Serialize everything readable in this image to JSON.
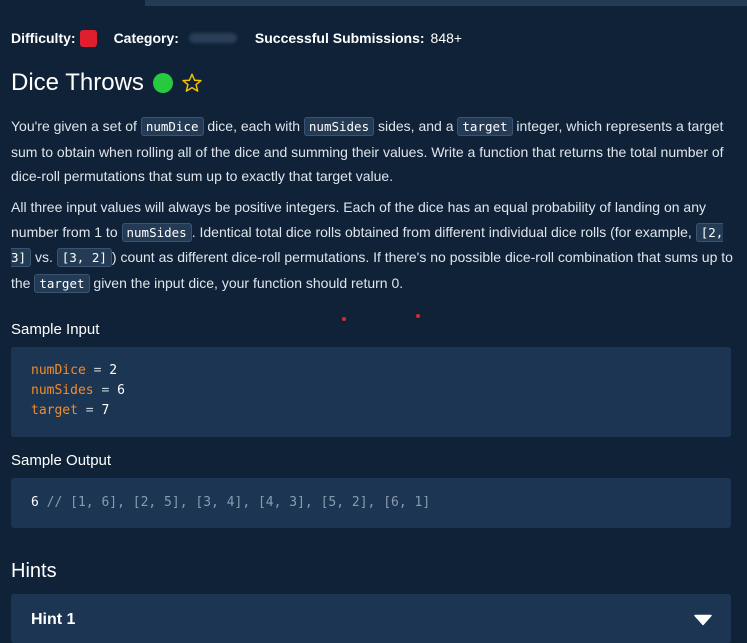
{
  "meta": {
    "difficulty_label": "Difficulty:",
    "difficulty_color": "#e01e2d",
    "category_label": "Category:",
    "subs_label": "Successful Submissions:",
    "subs_value": "848+"
  },
  "title": "Dice Throws",
  "status_color": "#27c93f",
  "description": {
    "p1": {
      "t1": "You're given a set of ",
      "c1": "numDice",
      "t2": " dice, each with ",
      "c2": "numSides",
      "t3": " sides, and a ",
      "c3": "target",
      "t4": " integer, which represents a target sum to obtain when rolling all of the dice and summing their values. Write a function that returns the total number of dice-roll permutations that sum up to exactly that target value."
    },
    "p2": {
      "t1": "All three input values will always be positive integers. Each of the dice has an equal probability of landing on any number from 1 to ",
      "c1": "numSides",
      "t2": ". Identical total dice rolls obtained from different individual dice rolls (for example, ",
      "c2": "[2, 3]",
      "t3": " vs. ",
      "c3": "[3, 2]",
      "t4": ") count as different dice-roll permutations. If there's no possible dice-roll combination that sums up to the ",
      "c4": "target",
      "t5": " given the input dice, your function should return 0."
    }
  },
  "sample_input": {
    "label": "Sample Input",
    "lines": [
      {
        "var": "numDice",
        "eq": " = ",
        "val": "2"
      },
      {
        "var": "numSides",
        "eq": " = ",
        "val": "6"
      },
      {
        "var": "target",
        "eq": " = ",
        "val": "7"
      }
    ]
  },
  "sample_output": {
    "label": "Sample Output",
    "value": "6",
    "comment": " // [1, 6], [2, 5], [3, 4], [4, 3], [5, 2], [6, 1]"
  },
  "hints": {
    "title": "Hints",
    "items": [
      {
        "label": "Hint 1"
      }
    ]
  }
}
